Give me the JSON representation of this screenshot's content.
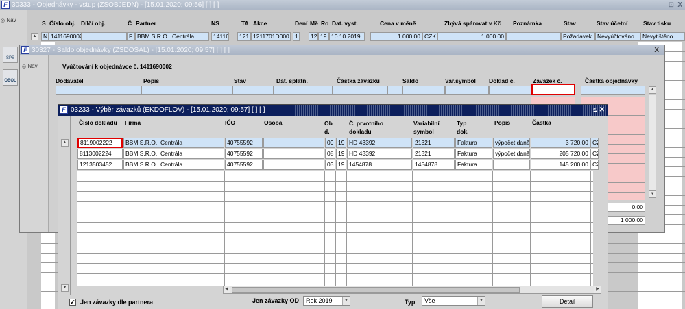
{
  "main_window": {
    "title": "30333 - Objednávky - vstup (ZSOBJEDN) - [15.01.2020; 09:56]  [ ]  [ ]",
    "nav": "Nav",
    "close": "X",
    "columns": [
      "S",
      "Číslo obj.",
      "Dílčí obj.",
      "Č",
      "Partner",
      "NS",
      "TA",
      "Akce",
      "Dení",
      "Mě",
      "Ro",
      "Dat. vyst.",
      "Cena v měně",
      "Zbývá spárovat v Kč",
      "Poznámka",
      "Stav",
      "Stav účetní",
      "Stav tisku"
    ],
    "row": {
      "s": "N",
      "cislo": "1411690002",
      "c": "F",
      "partner": "BBM S.R.O.. Centrála",
      "ns": "14116",
      "ta": "121",
      "akce": "1211701D000",
      "deni": "1",
      "me": "12",
      "ro": "19",
      "dat": "10.10.2019",
      "cena": "1 000.00",
      "mena": "CZK",
      "zbyva": "1 000.00",
      "stav": "Požadavek",
      "stav_ucetni": "Nevyúčtováno",
      "stav_tisku": "Nevytištěno"
    },
    "side_icons": [
      "SPS",
      "OBOL"
    ]
  },
  "saldo_window": {
    "title": "30327 - Saldo objednávky (ZSDOSAL) - [15.01.2020; 09:57]  [ ]  [ ]",
    "nav": "Nav",
    "close": "X",
    "heading": "Vyúčtování k objednávce č. 1411690002",
    "columns": [
      "Dodavatel",
      "Popis",
      "Stav",
      "Dat. splatn.",
      "Částka závazku",
      "Saldo",
      "Var.symbol",
      "Doklad č.",
      "Závazek č.",
      "Částka objednávky"
    ],
    "total1": "0.00",
    "total2": "1 000.00"
  },
  "zavazky_window": {
    "title": "03233 - Výběr závazků (EKDOFLOV) - [15.01.2020; 09:57]  [ ]  [ ]",
    "title_buttons": "≤ ✕",
    "columns": {
      "cislo": "Číslo dokladu",
      "firma": "Firma",
      "ico": "IČO",
      "osoba": "Osoba",
      "obd": "Ob d.",
      "prv": "Č. prvotního dokladu",
      "var": "Variabilní symbol",
      "typ": "Typ dok.",
      "popis": "Popis",
      "castka": "Částka"
    },
    "rows": [
      {
        "cislo": "8119002222",
        "firma": "BBM S.R.O.. Centrála",
        "ico": "40755592",
        "osoba": "",
        "ob": "09",
        "rok": "19",
        "prv": "HD 43392",
        "var": "21321",
        "typ": "Faktura",
        "popis": "výpočet daně",
        "castka": "3 720.00",
        "mena": "CZK"
      },
      {
        "cislo": "8113002224",
        "firma": "BBM S.R.O.. Centrála",
        "ico": "40755592",
        "osoba": "",
        "ob": "08",
        "rok": "19",
        "prv": "HD 43392",
        "var": "21321",
        "typ": "Faktura",
        "popis": "výpočet daně",
        "castka": "205 720.00",
        "mena": "CZK"
      },
      {
        "cislo": "1213503452",
        "firma": "BBM S.R.O.. Centrála",
        "ico": "40755592",
        "osoba": "",
        "ob": "03",
        "rok": "19",
        "prv": "1454878",
        "var": "1454878",
        "typ": "Faktura",
        "popis": "",
        "castka": "145 200.00",
        "mena": "CZK"
      }
    ],
    "footer": {
      "checkbox_label": "Jen závazky dle partnera",
      "checkbox_checked": true,
      "od_label": "Jen závazky OD",
      "od_value": "Rok 2019",
      "typ_label": "Typ",
      "typ_value": "Vše",
      "detail_button": "Detail"
    }
  }
}
